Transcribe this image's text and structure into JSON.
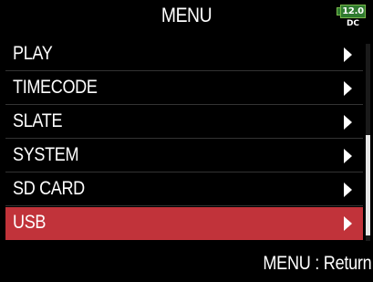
{
  "header": {
    "title": "MENU",
    "battery": {
      "level": "12.0",
      "source": "DC",
      "color": "#2f7a2f"
    }
  },
  "menu": {
    "items": [
      {
        "label": "PLAY",
        "icon": "chevron-right-icon"
      },
      {
        "label": "TIMECODE",
        "icon": "chevron-right-icon"
      },
      {
        "label": "SLATE",
        "icon": "chevron-right-icon"
      },
      {
        "label": "SYSTEM",
        "icon": "chevron-right-icon"
      },
      {
        "label": "SD CARD",
        "icon": "chevron-right-icon"
      },
      {
        "label": "USB",
        "icon": "chevron-right-icon",
        "selected": true
      }
    ],
    "selected_color": "#c1333a"
  },
  "footer": {
    "hint": "MENU : Return"
  }
}
